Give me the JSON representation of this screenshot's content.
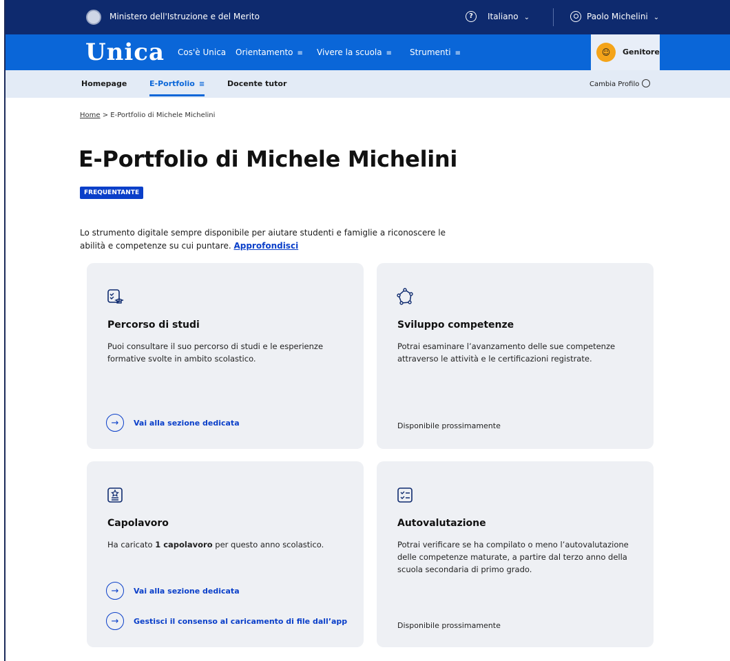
{
  "topbar": {
    "ministry": "Ministero dell'Istruzione e del Merito",
    "language": "Italiano",
    "user": "Paolo Michelini"
  },
  "mainnav": {
    "logo": "Unica",
    "items": [
      "Cos'è Unica",
      "Orientamento",
      "Vivere la scuola",
      "Strumenti"
    ],
    "role": "Genitore"
  },
  "subnav": {
    "items": [
      "Homepage",
      "E-Portfolio",
      "Docente tutor"
    ],
    "active": "E-Portfolio",
    "change_profile": "Cambia Profilo"
  },
  "breadcrumb": {
    "home": "Home",
    "separator": ">",
    "current": "E-Portfolio di Michele Michelini"
  },
  "page": {
    "title": "E-Portfolio di Michele Michelini",
    "status_badge": "FREQUENTANTE",
    "intro": "Lo strumento digitale sempre disponibile per aiutare studenti e famiglie a riconoscere le abilità e competenze su cui puntare.",
    "intro_link": "Approfondisci"
  },
  "cards": {
    "studi": {
      "title": "Percorso di studi",
      "desc": "Puoi consultare il suo percorso di studi e le esperienze formative svolte in ambito scolastico.",
      "cta": "Vai alla sezione dedicata"
    },
    "competenze": {
      "title": "Sviluppo competenze",
      "desc": "Potrai esaminare l’avanzamento delle sue competenze attraverso le attività e le certificazioni registrate.",
      "status": "Disponibile prossimamente"
    },
    "capolavoro": {
      "title": "Capolavoro",
      "desc_pre": "Ha caricato ",
      "desc_bold": "1 capolavoro",
      "desc_post": " per questo anno scolastico.",
      "cta1": "Vai alla sezione dedicata",
      "cta2": "Gestisci il consenso al caricamento di file dall’app"
    },
    "autovalutazione": {
      "title": "Autovalutazione",
      "desc": "Potrai verificare se ha compilato o meno l’autovalutazione delle competenze maturate, a partire dal terzo anno della scuola secondaria di primo grado.",
      "status": "Disponibile prossimamente"
    }
  },
  "colors": {
    "topbar": "#0e2a6e",
    "nav": "#0a66d8",
    "accent": "#0a3fc9",
    "role_badge": "#f4a41a",
    "card_bg": "#eef0f4"
  }
}
